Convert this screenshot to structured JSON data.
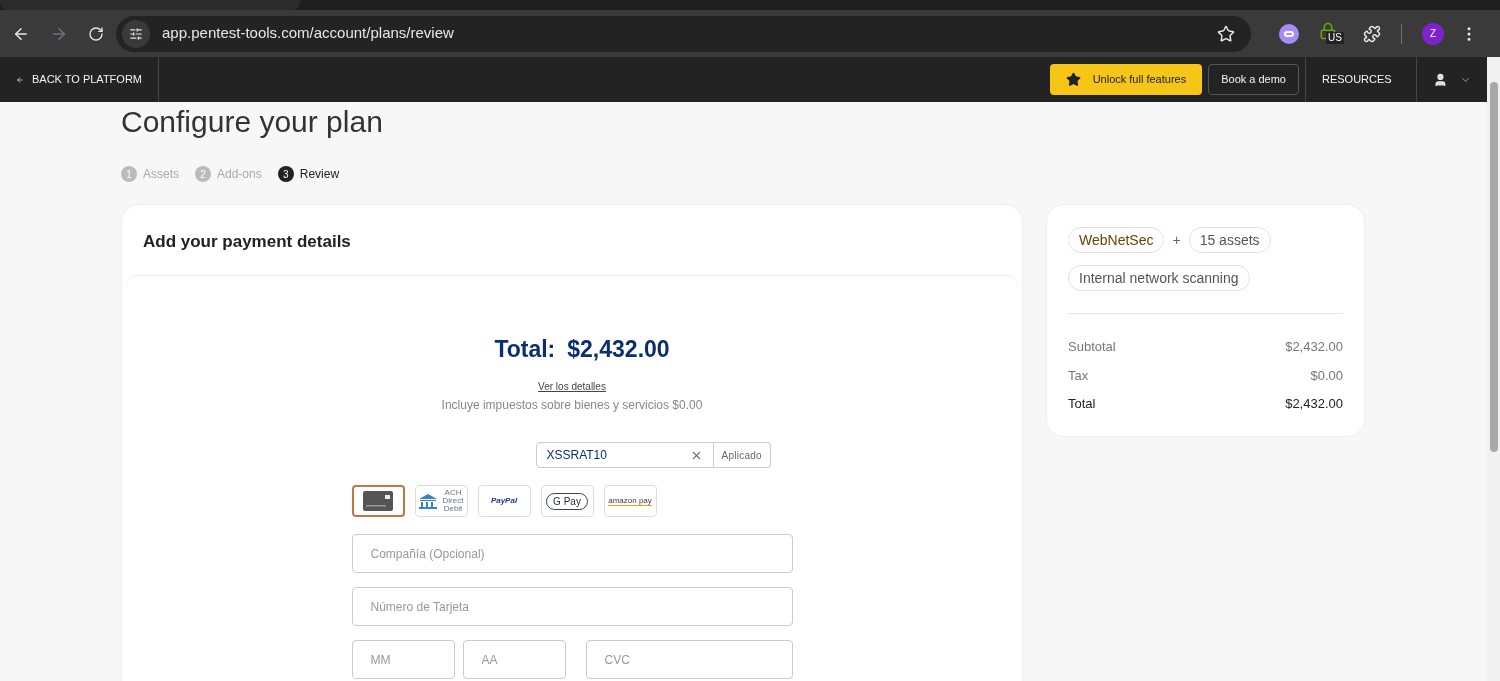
{
  "browser": {
    "url": "app.pentest-tools.com/account/plans/review",
    "profile_initial": "Z",
    "vpn_badge": "US"
  },
  "navbar": {
    "back": "BACK TO PLATFORM",
    "unlock": "Unlock full features",
    "demo": "Book a demo",
    "resources": "RESOURCES"
  },
  "page": {
    "title": "Configure your plan"
  },
  "steps": [
    {
      "number": "1",
      "label": "Assets",
      "selected": false
    },
    {
      "number": "2",
      "label": "Add-ons",
      "selected": false
    },
    {
      "number": "3",
      "label": "Review",
      "selected": true
    }
  ],
  "payment": {
    "title": "Add your payment details",
    "total_label": "Total:",
    "total": "$2,432.00",
    "details_link": "Ver los detalles",
    "tax_note": "Incluye impuestos sobre bienes y servicios $0.00",
    "coupon": {
      "value": "XSSRAT10",
      "status": "Aplicado"
    },
    "methods": [
      {
        "kind": "card",
        "selected": true
      },
      {
        "kind": "ach",
        "label": "ACH Direct Debit",
        "selected": false
      },
      {
        "kind": "paypal",
        "label": "PayPal",
        "selected": false
      },
      {
        "kind": "gpay",
        "label": "G Pay",
        "selected": false
      },
      {
        "kind": "amazon",
        "label": "amazon pay",
        "selected": false
      }
    ],
    "fields": [
      {
        "placeholder": "Compañía (Opcional)",
        "kind": "full"
      },
      {
        "placeholder": "Número de Tarjeta",
        "kind": "full"
      },
      {
        "placeholder": "MM",
        "kind": "small"
      },
      {
        "placeholder": "AA",
        "kind": "small"
      },
      {
        "placeholder": "CVC",
        "kind": "wide"
      }
    ]
  },
  "summary": {
    "tags": [
      {
        "label": "WebNetSec",
        "kind": "product"
      },
      {
        "label": "+",
        "kind": "plus"
      },
      {
        "label": "15 assets",
        "kind": "tag"
      },
      {
        "label": "Internal network scanning",
        "kind": "tag"
      }
    ],
    "rows": [
      {
        "label": "Subtotal",
        "value": "$2,432.00",
        "kind": "normal"
      },
      {
        "label": "Tax",
        "value": "$0.00",
        "kind": "normal"
      },
      {
        "label": "Total",
        "value": "$2,432.00",
        "kind": "total"
      }
    ]
  }
}
